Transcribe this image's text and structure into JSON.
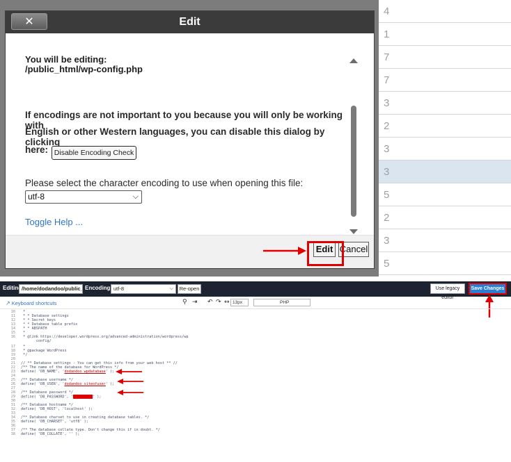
{
  "background_table": {
    "rows": [
      {
        "value": "4"
      },
      {
        "value": "1"
      },
      {
        "value": "7"
      },
      {
        "value": "7"
      },
      {
        "value": "3"
      },
      {
        "value": "2"
      },
      {
        "value": "3"
      },
      {
        "value": "3"
      },
      {
        "value": "5"
      },
      {
        "value": "2"
      },
      {
        "value": "3"
      },
      {
        "value": "5"
      }
    ]
  },
  "dialog": {
    "title": "Edit",
    "close_label": "✕",
    "editing_label": "You will be editing:",
    "file_path": "/public_html/wp-config.php",
    "encoding_text_line1": "If encodings are not important to you because you will only be working with",
    "encoding_text_line2": "English or other Western languages, you can disable this dialog by clicking",
    "encoding_text_line3": "here:",
    "disable_button_label": "Disable Encoding Check",
    "select_label": "Please select the character encoding to use when opening this file:",
    "encoding_value": "utf-8",
    "toggle_help_label": "Toggle Help ...",
    "edit_button_label": "Edit",
    "cancel_button_label": "Cancel"
  },
  "editor": {
    "editing_label": "Editing:",
    "path_value": "/home/dodandoo/public_h",
    "encoding_label": "Encoding:",
    "encoding_value": "utf-8",
    "reopen_label": "Re-open",
    "legacy_label": "Use legacy editor",
    "save_label": "Save Changes",
    "keyboard_shortcuts_label": "Keyboard shortcuts",
    "font_size": "13px",
    "language": "PHP",
    "code_lines": [
      {
        "n": "10",
        "t": " *"
      },
      {
        "n": "11",
        "t": " * * Database settings"
      },
      {
        "n": "12",
        "t": " * * Secret keys"
      },
      {
        "n": "13",
        "t": " * * Database table prefix"
      },
      {
        "n": "14",
        "t": " * * ABSPATH"
      },
      {
        "n": "15",
        "t": " *"
      },
      {
        "n": "16",
        "t": " * @link https://developer.wordpress.org/advanced-administration/wordpress/wp"
      },
      {
        "n": "",
        "t": "       config/"
      },
      {
        "n": "17",
        "t": " *"
      },
      {
        "n": "18",
        "t": " * @package WordPress"
      },
      {
        "n": "19",
        "t": " */"
      },
      {
        "n": "20",
        "t": ""
      },
      {
        "n": "21",
        "t": "// ** Database settings - You can get this info from your web host ** //"
      },
      {
        "n": "22",
        "t": "/** The name of the database for WordPress */"
      },
      {
        "n": "23",
        "t": "define( 'DB_NAME', '"
      },
      {
        "n": "24",
        "t": ""
      },
      {
        "n": "25",
        "t": "/** Database username */"
      },
      {
        "n": "26",
        "t": "define( 'DB_USER', '"
      },
      {
        "n": "27",
        "t": ""
      },
      {
        "n": "28",
        "t": "/** Database password */"
      },
      {
        "n": "29",
        "t": "define( 'DB_PASSWORD', '"
      },
      {
        "n": "30",
        "t": ""
      },
      {
        "n": "31",
        "t": "/** Database hostname */"
      },
      {
        "n": "32",
        "t": "define( 'DB_HOST', 'localhost' );"
      },
      {
        "n": "33",
        "t": ""
      },
      {
        "n": "34",
        "t": "/** Database charset to use in creating database tables. */"
      },
      {
        "n": "35",
        "t": "define( 'DB_CHARSET', 'utf8' );"
      },
      {
        "n": "36",
        "t": ""
      },
      {
        "n": "37",
        "t": "/** The database collate type. Don't change this if in doubt. */"
      },
      {
        "n": "38",
        "t": "define( 'DB_COLLATE', '' );"
      }
    ],
    "db_name_value": "dodandoo_wpdatabase",
    "db_user_value": "dodandoo_siteofuser",
    "line_end": "' );"
  },
  "colors": {
    "annotation_red": "#e10000",
    "save_blue": "#2a7fd5",
    "link_blue": "#2f75c9"
  }
}
